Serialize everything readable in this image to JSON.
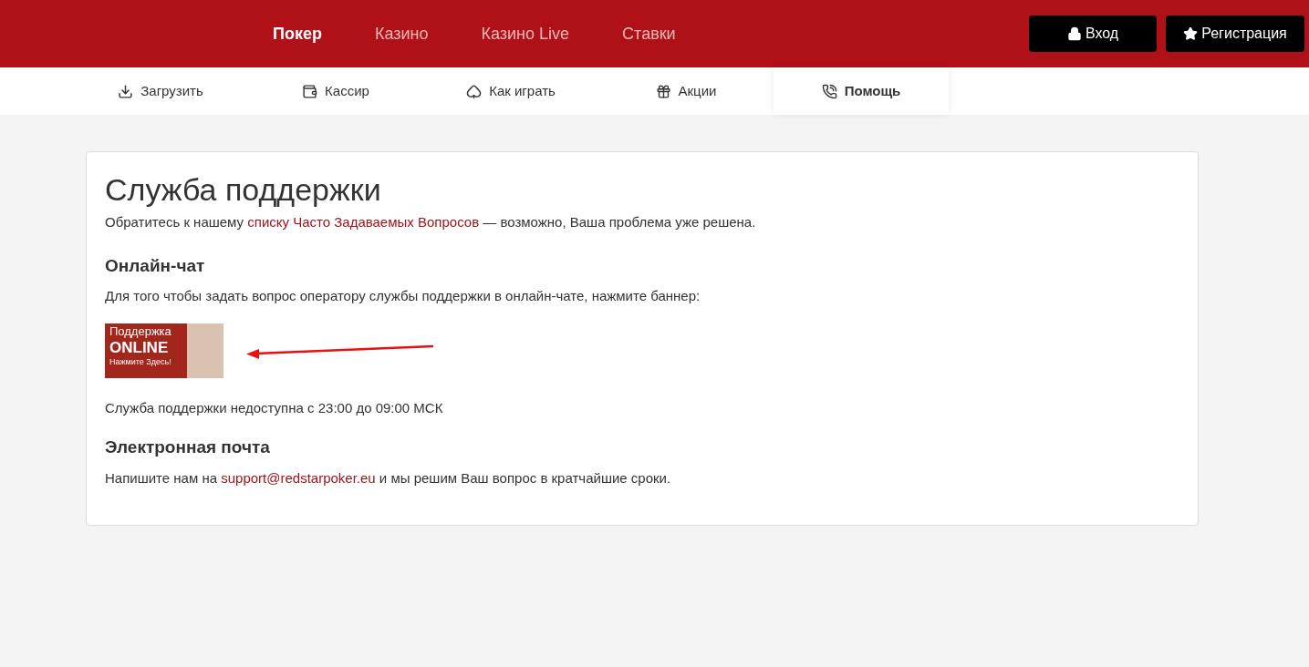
{
  "top_nav": [
    {
      "label": "Покер",
      "selected": true
    },
    {
      "label": "Казино",
      "selected": false
    },
    {
      "label": "Казино Live",
      "selected": false
    },
    {
      "label": "Ставки",
      "selected": false
    }
  ],
  "auth_buttons": [
    {
      "label": "Вход",
      "kind": "lock"
    },
    {
      "label": "Регистрация",
      "kind": "star"
    }
  ],
  "sub_nav": [
    {
      "label": "Загрузить",
      "kind": "download",
      "selected": false
    },
    {
      "label": "Кассир",
      "kind": "wallet",
      "selected": false
    },
    {
      "label": "Как играть",
      "kind": "cards",
      "selected": false
    },
    {
      "label": "Акции",
      "kind": "gift",
      "selected": false
    },
    {
      "label": "Помощь",
      "kind": "support",
      "selected": true
    }
  ],
  "content": {
    "title": "Служба поддержки",
    "intro": {
      "before": "Обратитесь к нашему ",
      "link": "списку Часто Задаваемых Вопросов",
      "after": " — возможно, Ваша проблема уже решена."
    },
    "chat_heading": "Онлайн-чат",
    "chat_text": "Для того чтобы задать вопрос оператору службы поддержки в онлайн-чате, нажмите баннер:",
    "banner": {
      "line_1": "Поддержка",
      "line_2": "ONLINE",
      "line_3": "Нажмите Здесь!"
    },
    "hours": "Служба поддержки недоступна с 23:00 до 09:00 МСК",
    "email_heading": "Электронная почта",
    "email": {
      "before": "Напишите нам на ",
      "link": "support@redstarpoker.eu",
      "after": " и мы решим Ваш вопрос в кратчайшие сроки."
    }
  }
}
